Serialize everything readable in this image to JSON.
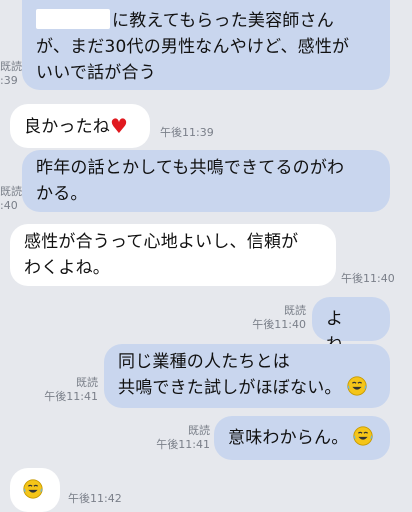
{
  "messages": [
    {
      "direction": "sent",
      "lines": [
        "に教えてもらった美容師さん",
        "が、まだ30代の男性なんやけど、感性が",
        "いいで話が合う"
      ],
      "read_label": "既読",
      "time_partial": ":39"
    },
    {
      "direction": "received",
      "text": "良かったね",
      "emoji": "heart-icon",
      "time": "午後11:39"
    },
    {
      "direction": "sent",
      "lines": [
        "昨年の話とかしても共鳴できてるのがわ",
        "かる。"
      ],
      "read_label": "既読",
      "time_partial": ":40"
    },
    {
      "direction": "received",
      "lines": [
        "感性が合うって心地よいし、信頼が",
        "わくよね。"
      ],
      "time": "午後11:40"
    },
    {
      "direction": "sent",
      "text": "よね。",
      "read_label": "既読",
      "time": "午後11:40"
    },
    {
      "direction": "sent",
      "lines": [
        "同じ業種の人たちとは",
        "共鳴できた試しがほぼない。"
      ],
      "emoji": "laughing-tears-emoji-icon",
      "read_label": "既読",
      "time": "午後11:41"
    },
    {
      "direction": "sent",
      "text": "意味わからん。",
      "emoji": "laughing-tears-emoji-icon",
      "read_label": "既読",
      "time": "午後11:41"
    },
    {
      "direction": "received",
      "text": "",
      "emoji": "laughing-tears-emoji-icon",
      "time": "午後11:42"
    }
  ],
  "heart_glyph": "♥",
  "colors": {
    "sent_bubble": "#c9d6ee",
    "received_bubble": "#ffffff",
    "background": "#e6e8ed",
    "meta_text": "#7a7f89",
    "heart": "#e0191f"
  }
}
